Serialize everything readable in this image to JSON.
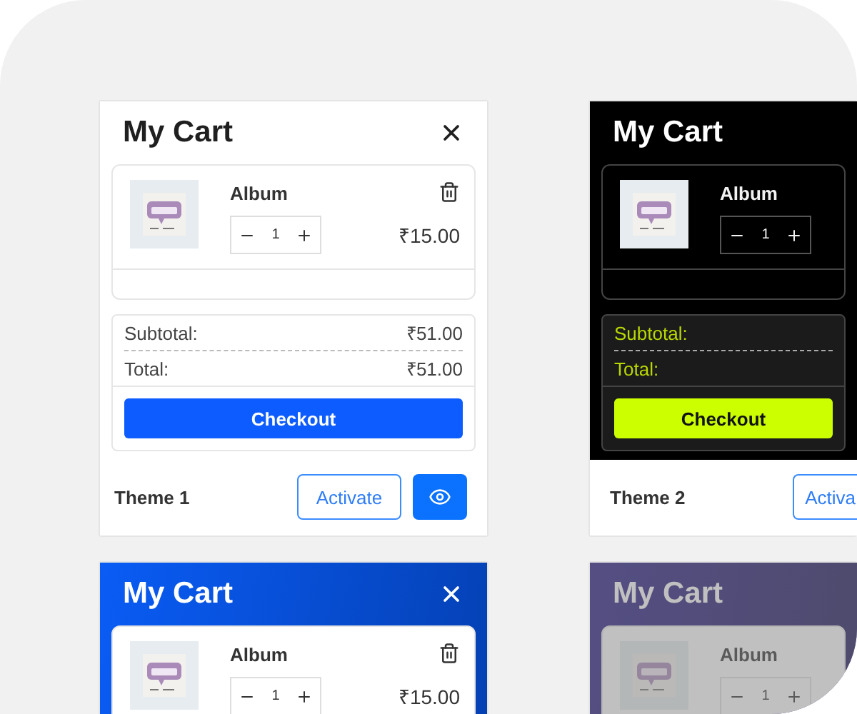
{
  "themes": [
    {
      "kind": "light",
      "title": "My Cart",
      "close": true,
      "item": {
        "name": "Album",
        "quantity": "1",
        "price": "₹15.00",
        "remove": true
      },
      "totals": [
        {
          "label": "Subtotal:",
          "value": "₹51.00"
        },
        {
          "label": "Total:",
          "value": "₹51.00"
        }
      ],
      "checkout": "Checkout",
      "footer": {
        "name": "Theme 1",
        "activate": "Activate",
        "preview": true
      }
    },
    {
      "kind": "dark",
      "title": "My Cart",
      "item": {
        "name": "Album",
        "quantity": "1"
      },
      "totals": [
        {
          "label": "Subtotal:"
        },
        {
          "label": "Total:"
        }
      ],
      "checkout": "Checkout",
      "footer": {
        "name": "Theme 2",
        "activate": "Activa"
      }
    },
    {
      "kind": "blue",
      "title": "My Cart",
      "close": true,
      "item": {
        "name": "Album",
        "quantity": "1",
        "price": "₹15.00",
        "remove": true
      }
    },
    {
      "kind": "indigo",
      "dimmed": true,
      "title": "My Cart",
      "item": {
        "name": "Album",
        "quantity": "1"
      }
    }
  ]
}
